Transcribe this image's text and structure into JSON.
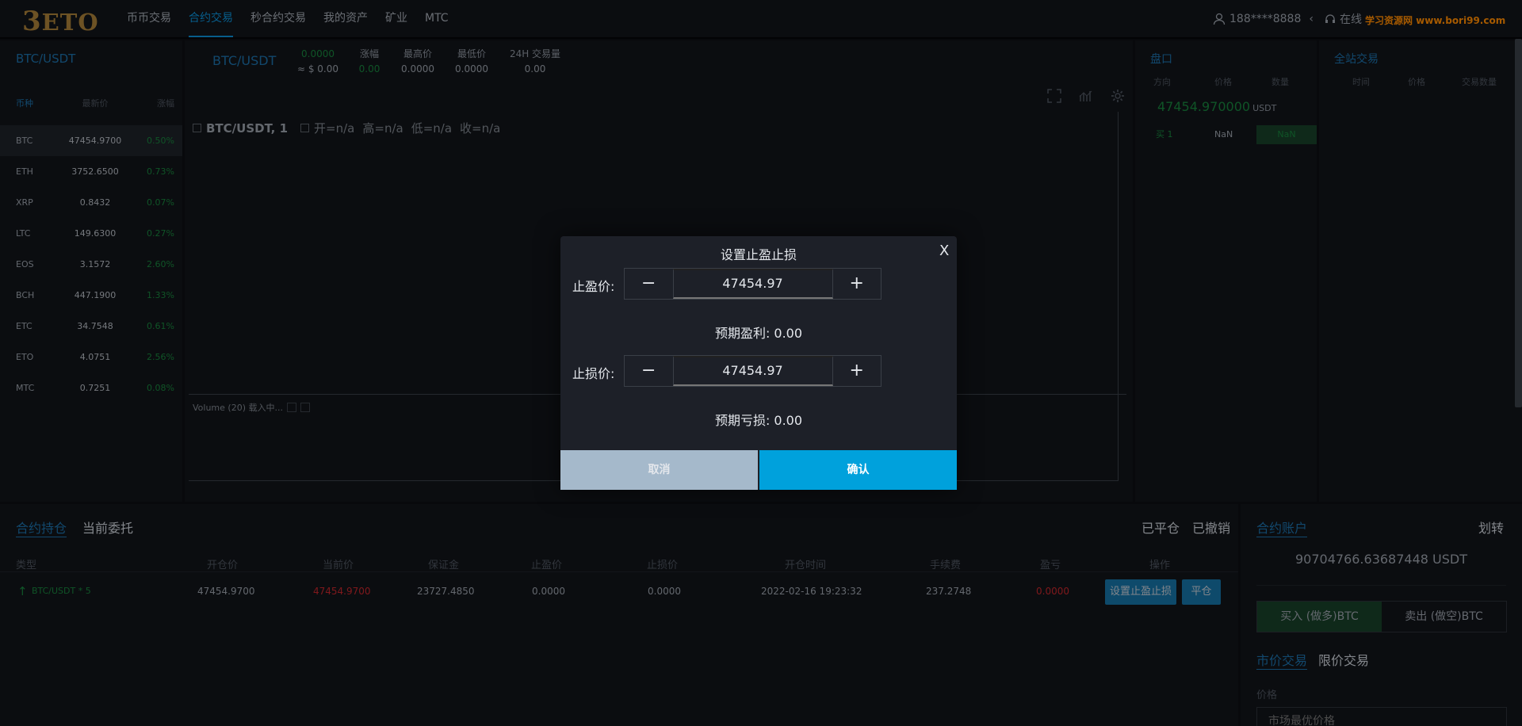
{
  "nav": {
    "logo_num": "3",
    "logo_text": "ETO",
    "links": [
      "币币交易",
      "合约交易",
      "秒合约交易",
      "我的资产",
      "矿业",
      "MTC"
    ],
    "active_index": 1,
    "user": "188****8888",
    "online": "在线",
    "watermark": "学习资源网 www.bori99.com"
  },
  "symbols": {
    "title": "BTC/USDT",
    "headers": [
      "币种",
      "最新价",
      "涨幅"
    ],
    "rows": [
      {
        "name": "BTC",
        "price": "47454.9700",
        "change": "0.50%"
      },
      {
        "name": "ETH",
        "price": "3752.6500",
        "change": "0.73%"
      },
      {
        "name": "XRP",
        "price": "0.8432",
        "change": "0.07%"
      },
      {
        "name": "LTC",
        "price": "149.6300",
        "change": "0.27%"
      },
      {
        "name": "EOS",
        "price": "3.1572",
        "change": "2.60%"
      },
      {
        "name": "BCH",
        "price": "447.1900",
        "change": "1.33%"
      },
      {
        "name": "ETC",
        "price": "34.7548",
        "change": "0.61%"
      },
      {
        "name": "ETO",
        "price": "4.0751",
        "change": "2.56%"
      },
      {
        "name": "MTC",
        "price": "0.7251",
        "change": "0.08%"
      }
    ]
  },
  "ticker": {
    "pair": "BTC/USDT",
    "last": "0.0000",
    "last_usd": "≈ $ 0.00",
    "change_label": "涨幅",
    "change": "0.00",
    "high_label": "最高价",
    "high": "0.0000",
    "low_label": "最低价",
    "low": "0.0000",
    "vol_label": "24H 交易量",
    "vol": "0.00"
  },
  "chart": {
    "pair": "BTC/USDT, 1",
    "open": "开=n/a",
    "high": "高=n/a",
    "low": "低=n/a",
    "close": "收=n/a",
    "volume": "Volume (20) 载入中..."
  },
  "orderbook": {
    "title": "盘口",
    "headers": [
      "方向",
      "价格",
      "数量"
    ],
    "price": "47454.970000",
    "unit": "USDT",
    "row": {
      "side": "买 1",
      "price": "NaN",
      "qty": "NaN"
    }
  },
  "trades": {
    "title": "全站交易",
    "headers": [
      "时间",
      "价格",
      "交易数量"
    ]
  },
  "positions": {
    "tab_active": "合约持仓",
    "tab_other": "当前委托",
    "tab_closed": "已平仓",
    "tab_cancelled": "已撤销",
    "headers": [
      "类型",
      "开仓价",
      "当前价",
      "保证金",
      "止盈价",
      "止损价",
      "开仓时间",
      "手续费",
      "盈亏",
      "操作"
    ],
    "row": {
      "type": "BTC/USDT * 5",
      "open": "47454.9700",
      "current": "47454.9700",
      "margin": "23727.4850",
      "tp": "0.0000",
      "sl": "0.0000",
      "time": "2022-02-16 19:23:32",
      "fee": "237.2748",
      "pnl": "0.0000",
      "btn_sl": "设置止盈止损",
      "btn_close": "平仓"
    }
  },
  "account": {
    "title": "合约账户",
    "transfer": "划转",
    "balance": "90704766.63687448 USDT",
    "buy": "买入 (做多)BTC",
    "sell": "卖出 (做空)BTC",
    "market": "市价交易",
    "limit": "限价交易",
    "price_label": "价格",
    "price_placeholder": "市场最优价格"
  },
  "modal": {
    "title": "设置止盈止损",
    "close": "X",
    "tp_label": "止盈价:",
    "tp_value": "47454.97",
    "expect_profit": "预期盈利: 0.00",
    "sl_label": "止损价:",
    "sl_value": "47454.97",
    "expect_loss": "预期亏损: 0.00",
    "minus": "−",
    "plus": "+",
    "cancel": "取消",
    "confirm": "确认"
  }
}
